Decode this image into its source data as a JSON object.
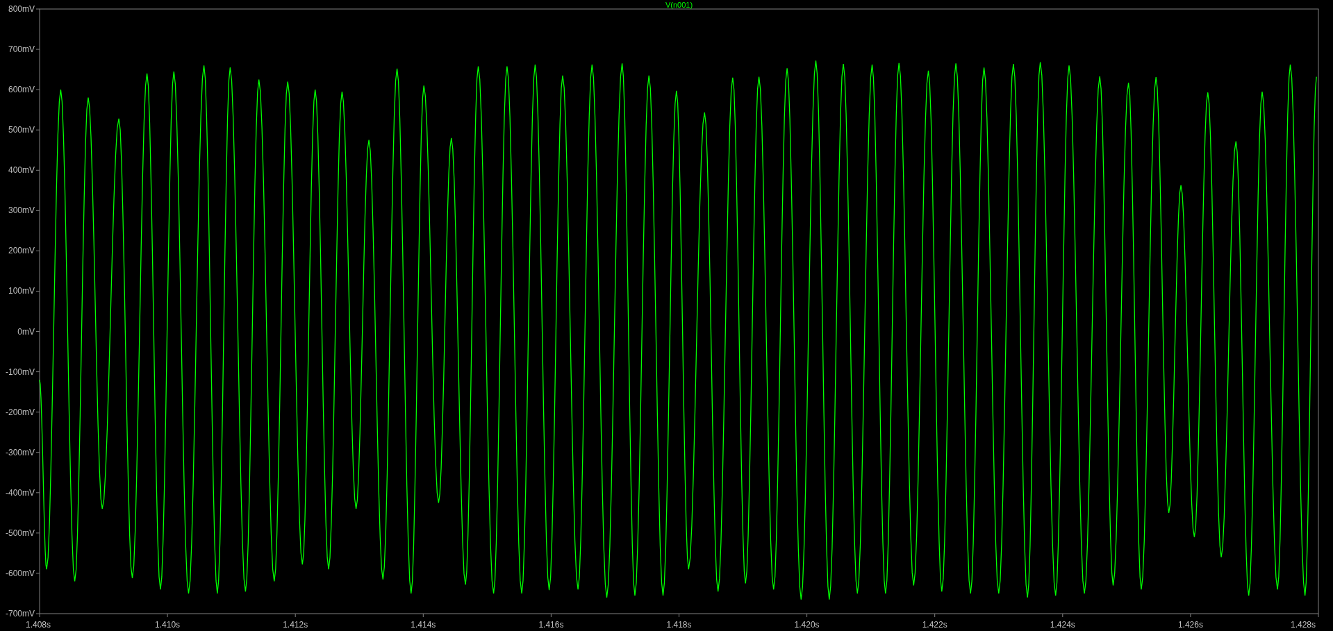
{
  "plot": {
    "chart_data": {
      "type": "line",
      "x": [
        1.408,
        1.40811,
        1.40833,
        1.40855,
        1.40876,
        1.40898,
        1.40924,
        1.40945,
        1.40968,
        1.40989,
        1.4101,
        1.41033,
        1.41057,
        1.41078,
        1.41098,
        1.41122,
        1.41143,
        1.41167,
        1.41188,
        1.41211,
        1.41231,
        1.41252,
        1.41273,
        1.41295,
        1.41315,
        1.41337,
        1.41359,
        1.41381,
        1.41401,
        1.41424,
        1.41444,
        1.41466,
        1.41486,
        1.4151,
        1.41531,
        1.41554,
        1.41575,
        1.41597,
        1.41618,
        1.41642,
        1.41664,
        1.41687,
        1.41711,
        1.41731,
        1.41753,
        1.41775,
        1.41796,
        1.41815,
        1.4184,
        1.41861,
        1.41884,
        1.41904,
        1.41925,
        1.41948,
        1.41969,
        1.41991,
        1.42014,
        1.42035,
        1.42057,
        1.42079,
        1.42102,
        1.42123,
        1.42144,
        1.42167,
        1.4219,
        1.42211,
        1.42233,
        1.42256,
        1.42277,
        1.423,
        1.42323,
        1.42345,
        1.42365,
        1.42389,
        1.4241,
        1.42434,
        1.42458,
        1.42479,
        1.42503,
        1.42523,
        1.42546,
        1.42566,
        1.42585,
        1.42606,
        1.42627,
        1.42648,
        1.42671,
        1.42691,
        1.42712,
        1.42736,
        1.42756,
        1.42779,
        1.42797
      ],
      "series": [
        {
          "name": "V(n001)",
          "color": "#00ff00",
          "values": [
            -120,
            -590,
            600,
            -620,
            580,
            -440,
            528,
            -612,
            640,
            -640,
            645,
            -650,
            660,
            -650,
            655,
            -645,
            625,
            -620,
            620,
            -578,
            600,
            -590,
            595,
            -440,
            475,
            -615,
            652,
            -650,
            610,
            -425,
            480,
            -628,
            658,
            -650,
            658,
            -650,
            662,
            -642,
            635,
            -640,
            662,
            -660,
            665,
            -655,
            635,
            -655,
            597,
            -590,
            543,
            -645,
            630,
            -625,
            632,
            -640,
            653,
            -665,
            672,
            -665,
            664,
            -650,
            662,
            -650,
            666,
            -630,
            647,
            -645,
            665,
            -650,
            655,
            -650,
            664,
            -660,
            668,
            -655,
            660,
            -650,
            633,
            -630,
            617,
            -640,
            631,
            -450,
            363,
            -510,
            593,
            -560,
            472,
            -655,
            595,
            -640,
            662,
            -655,
            632
          ]
        }
      ],
      "xlim": [
        1.408,
        1.428
      ],
      "ylim": [
        -700,
        800
      ],
      "xticks": [
        {
          "value": 1.408,
          "label": "1.408s"
        },
        {
          "value": 1.41,
          "label": "1.410s"
        },
        {
          "value": 1.412,
          "label": "1.412s"
        },
        {
          "value": 1.414,
          "label": "1.414s"
        },
        {
          "value": 1.416,
          "label": "1.416s"
        },
        {
          "value": 1.418,
          "label": "1.418s"
        },
        {
          "value": 1.42,
          "label": "1.420s"
        },
        {
          "value": 1.422,
          "label": "1.422s"
        },
        {
          "value": 1.424,
          "label": "1.424s"
        },
        {
          "value": 1.426,
          "label": "1.426s"
        },
        {
          "value": 1.428,
          "label": "1.428s"
        }
      ],
      "yticks": [
        {
          "value": 800,
          "label": "800mV"
        },
        {
          "value": 700,
          "label": "700mV"
        },
        {
          "value": 600,
          "label": "600mV"
        },
        {
          "value": 500,
          "label": "500mV"
        },
        {
          "value": 400,
          "label": "400mV"
        },
        {
          "value": 300,
          "label": "300mV"
        },
        {
          "value": 200,
          "label": "200mV"
        },
        {
          "value": 100,
          "label": "100mV"
        },
        {
          "value": 0,
          "label": "0mV"
        },
        {
          "value": -100,
          "label": "-100mV"
        },
        {
          "value": -200,
          "label": "-200mV"
        },
        {
          "value": -300,
          "label": "-300mV"
        },
        {
          "value": -400,
          "label": "-400mV"
        },
        {
          "value": -500,
          "label": "-500mV"
        },
        {
          "value": -600,
          "label": "-600mV"
        },
        {
          "value": -700,
          "label": "-700mV"
        }
      ]
    }
  }
}
